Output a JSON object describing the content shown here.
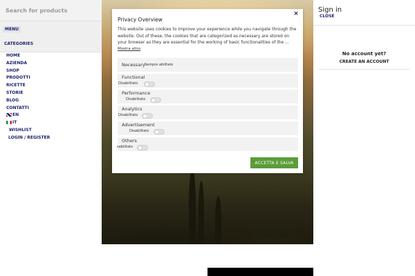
{
  "left_panel": {
    "search_placeholder": "Search for products",
    "tab_menu": "MENU",
    "tab_categories": "CATEGORIES",
    "menu_items": [
      "HOME",
      "AZIENDA",
      "SHOP",
      "PRODOTTI",
      "RICETTE",
      "STORIE",
      "BLOG",
      "CONTATTI"
    ],
    "lang_en": "EN",
    "lang_it": "IT",
    "wishlist": "WISHLIST",
    "login": "LOGIN / REGISTER"
  },
  "slider": {
    "slide_1": "01",
    "slide_2": "02"
  },
  "right_panel": {
    "title": "Sign in",
    "close": "CLOSE",
    "no_account": "No account yet?",
    "create_account": "CREATE AN ACCOUNT"
  },
  "privacy_modal": {
    "title": "Privacy Overview",
    "close_icon": "×",
    "description": "This website uses cookies to improve your experience while you navigate through the website. Out of these, the cookies that are categorized as necessary are stored on your browser as they are essential for the working of basic functionalities of the ...",
    "more_link": "Mostra altro",
    "categories": [
      {
        "name": "Necessary",
        "status": "Sempre abilitato"
      },
      {
        "name": "Functional",
        "status": "Disabilitato"
      },
      {
        "name": "Performance",
        "status": "Disabilitato"
      },
      {
        "name": "Analytics",
        "status": "Disabilitato"
      },
      {
        "name": "Advertisement",
        "status": "Disabilitato"
      },
      {
        "name": "Others",
        "status": "sabilitato"
      }
    ],
    "save_button": "ACCETTA E SALVA",
    "accent_color": "#5b9c3a"
  }
}
